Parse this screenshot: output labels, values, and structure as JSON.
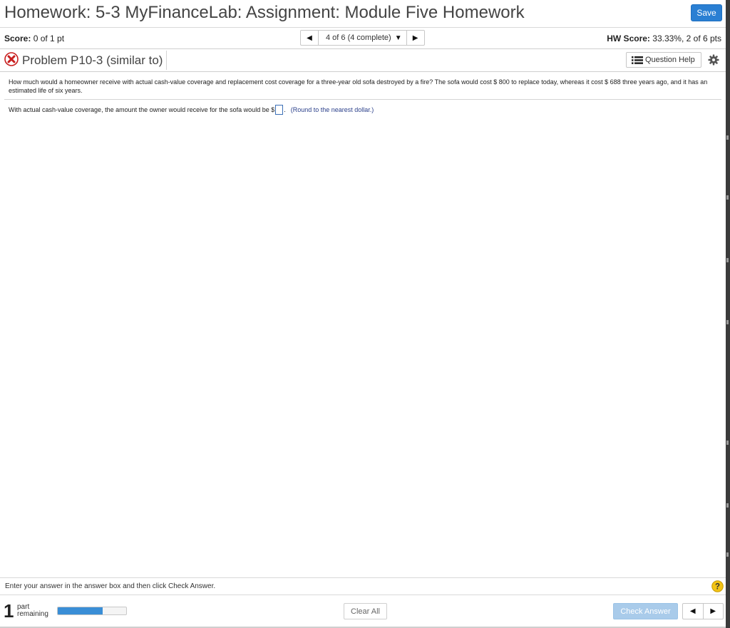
{
  "header": {
    "title": "Homework: 5-3 MyFinanceLab: Assignment: Module Five Homework",
    "save_label": "Save",
    "accent_color": "#2a7fd3"
  },
  "score": {
    "label": "Score:",
    "value": "0 of 1 pt",
    "hw_label": "HW Score:",
    "hw_value": "33.33%, 2 of 6 pts"
  },
  "navigator": {
    "prev_icon": "triangle-left-icon",
    "status": "4 of 6 (4 complete)",
    "dropdown_icon": "triangle-down-icon",
    "next_icon": "triangle-right-icon"
  },
  "problem": {
    "status_icon": "red-x-circle-icon",
    "title": "Problem P10-3 (similar to)",
    "question_help_label": "Question Help",
    "question_help_icon": "list-icon",
    "settings_icon": "gear-icon"
  },
  "question": {
    "text": "How much would a homeowner receive with actual cash-value coverage and replacement cost coverage for a three-year old sofa destroyed by a fire? The sofa would cost $ 800 to replace today, whereas it cost $ 688 three years ago, and it has an estimated life of six years.",
    "answer_prefix": "With actual cash-value coverage, the amount the owner would receive for the sofa would be $",
    "answer_value": "",
    "answer_suffix": ".",
    "hint": "(Round to the nearest dollar.)"
  },
  "footer": {
    "instruction": "Enter your answer in the answer box and then click Check Answer.",
    "help_icon": "question-mark-icon",
    "parts_count": "1",
    "parts_label_line1": "part",
    "parts_label_line2": "remaining",
    "progress_percent": 66,
    "clear_all_label": "Clear All",
    "check_answer_label": "Check Answer",
    "prev_icon": "triangle-left-icon",
    "next_icon": "triangle-right-icon"
  }
}
